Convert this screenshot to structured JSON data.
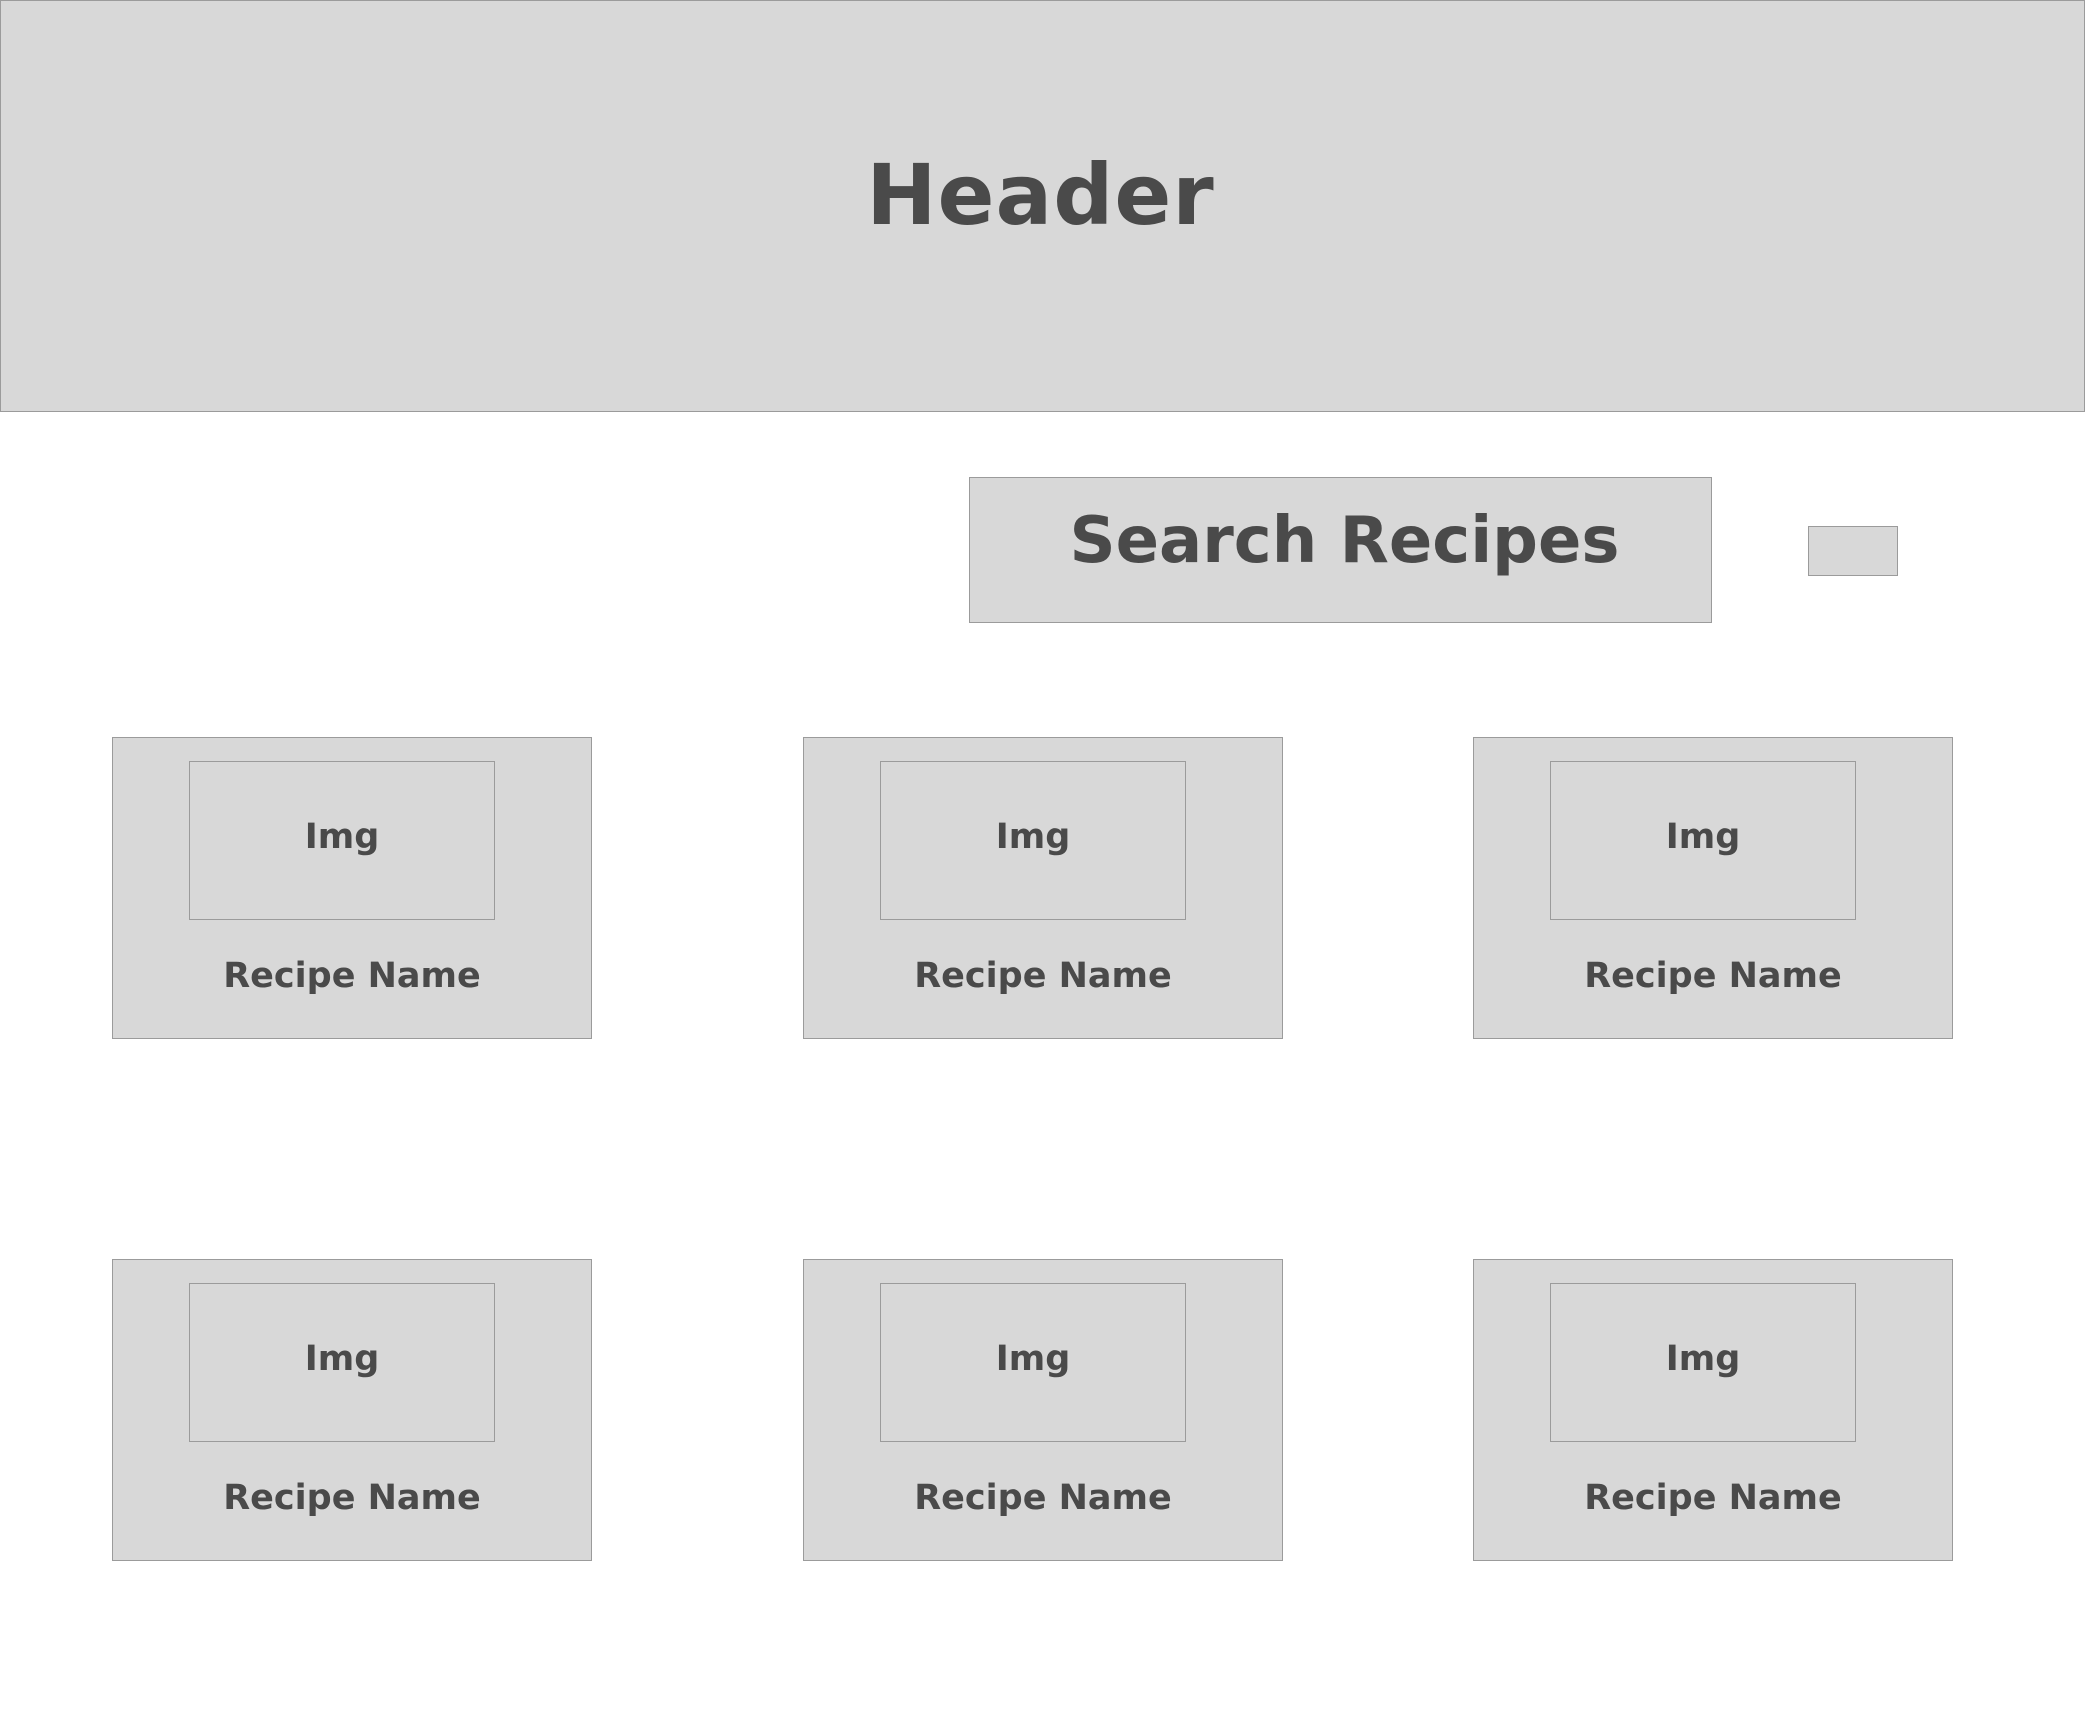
{
  "header": {
    "title": "Header"
  },
  "search": {
    "label": "Search Recipes"
  },
  "recipes": [
    {
      "image_label": "Img",
      "name": "Recipe Name"
    },
    {
      "image_label": "Img",
      "name": "Recipe Name"
    },
    {
      "image_label": "Img",
      "name": "Recipe Name"
    },
    {
      "image_label": "Img",
      "name": "Recipe Name"
    },
    {
      "image_label": "Img",
      "name": "Recipe Name"
    },
    {
      "image_label": "Img",
      "name": "Recipe Name"
    }
  ],
  "colors": {
    "placeholder_fill": "#d8d8d8",
    "placeholder_border": "#9b9b9b",
    "text": "#4a4a4a",
    "background": "#ffffff"
  }
}
